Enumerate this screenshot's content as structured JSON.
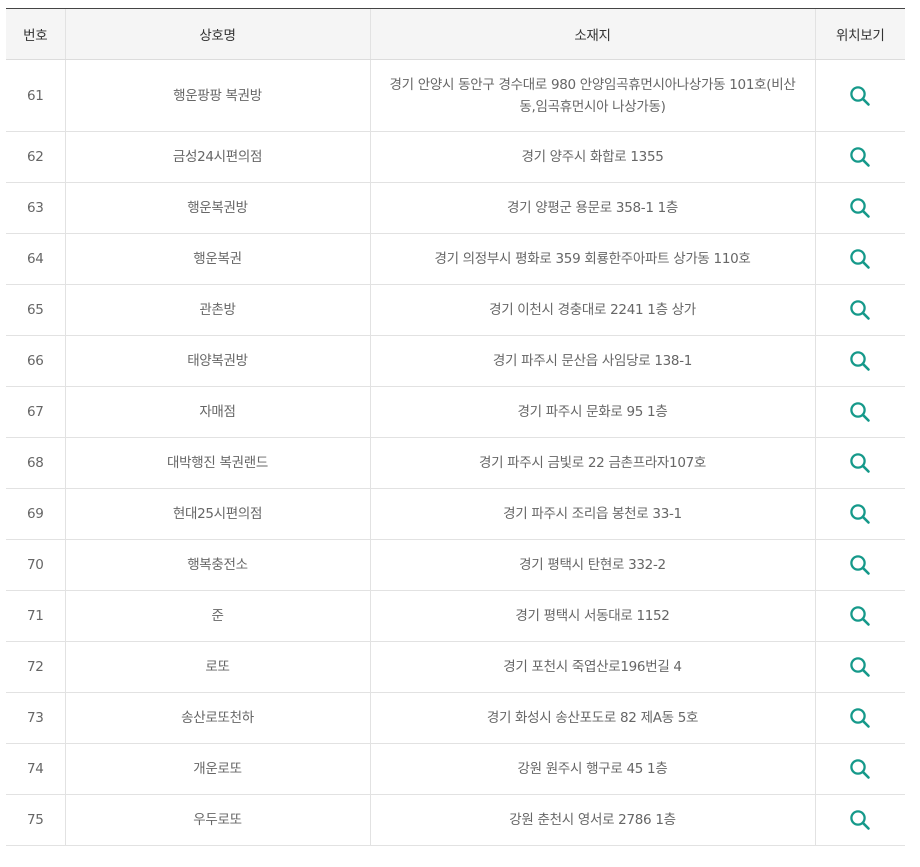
{
  "table": {
    "headers": {
      "no": "번호",
      "name": "상호명",
      "address": "소재지",
      "location": "위치보기"
    },
    "icon": "search-icon",
    "icon_color": "#15998a",
    "rows": [
      {
        "no": "61",
        "name": "행운팡팡 복권방",
        "address": "경기 안양시 동안구 경수대로 980 안양임곡휴먼시아나상가동 101호(비산동,임곡휴먼시아 나상가동)"
      },
      {
        "no": "62",
        "name": "금성24시편의점",
        "address": "경기 양주시 화합로 1355"
      },
      {
        "no": "63",
        "name": "행운복권방",
        "address": "경기 양평군 용문로 358-1 1층"
      },
      {
        "no": "64",
        "name": "행운복권",
        "address": "경기 의정부시 평화로 359 회룡한주아파트 상가동 110호"
      },
      {
        "no": "65",
        "name": "관촌방",
        "address": "경기 이천시 경충대로 2241 1층 상가"
      },
      {
        "no": "66",
        "name": "태양복권방",
        "address": "경기 파주시 문산읍 사임당로 138-1"
      },
      {
        "no": "67",
        "name": "자매점",
        "address": "경기 파주시 문화로 95 1층"
      },
      {
        "no": "68",
        "name": "대박행진 복권랜드",
        "address": "경기 파주시 금빛로 22 금촌프라자107호"
      },
      {
        "no": "69",
        "name": "현대25시편의점",
        "address": "경기 파주시 조리읍 봉천로 33-1"
      },
      {
        "no": "70",
        "name": "행복충전소",
        "address": "경기 평택시 탄현로 332-2"
      },
      {
        "no": "71",
        "name": "준",
        "address": "경기 평택시 서동대로 1152"
      },
      {
        "no": "72",
        "name": "로또",
        "address": "경기 포천시 죽엽산로196번길 4"
      },
      {
        "no": "73",
        "name": "송산로또천하",
        "address": "경기 화성시 송산포도로 82 제A동 5호"
      },
      {
        "no": "74",
        "name": "개운로또",
        "address": "강원 원주시 행구로 45 1층"
      },
      {
        "no": "75",
        "name": "우두로또",
        "address": "강원 춘천시 영서로 2786 1층"
      }
    ]
  }
}
